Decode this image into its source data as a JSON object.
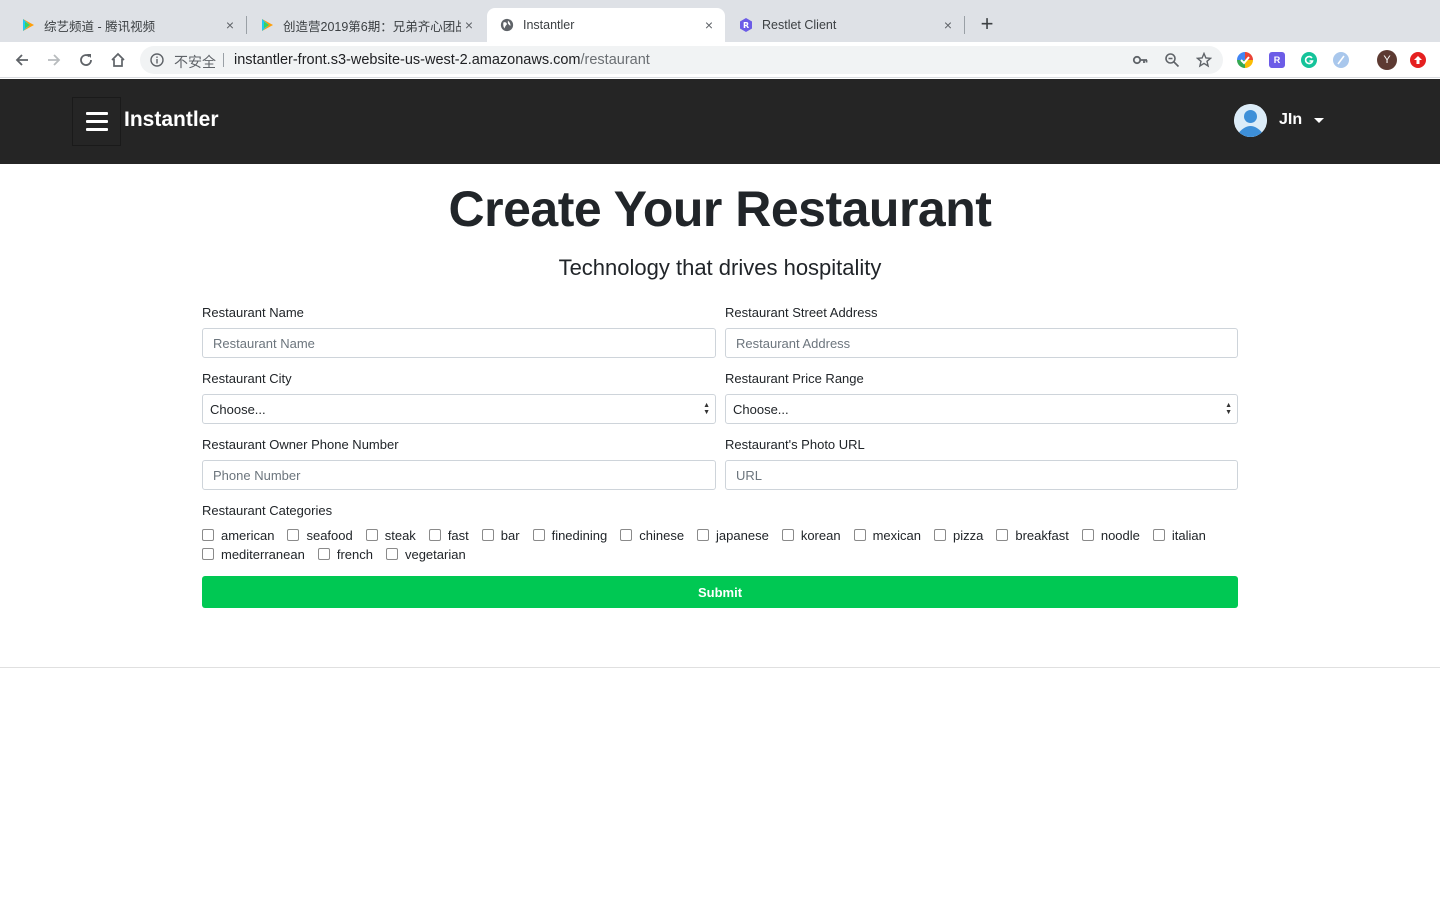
{
  "browser": {
    "tabs": [
      {
        "title": "综艺频道 - 腾讯视频",
        "favicon": "tencent-video-icon",
        "active": false
      },
      {
        "title": "创造营2019第6期：兄弟齐心团战",
        "favicon": "tencent-video-icon",
        "active": false
      },
      {
        "title": "Instantler",
        "favicon": "globe-icon",
        "active": true
      },
      {
        "title": "Restlet Client",
        "favicon": "restlet-icon",
        "active": false
      }
    ],
    "new_tab_symbol": "+",
    "close_symbol": "×",
    "security_label": "不安全",
    "url_host": "instantler-front.s3-website-us-west-2.amazonaws.com",
    "url_path": "/restaurant",
    "profile_initial": "Y",
    "extension_badge": "R"
  },
  "navbar": {
    "brand": "Instantler",
    "user_name": "JIn"
  },
  "page": {
    "title": "Create Your Restaurant",
    "subtitle": "Technology that drives hospitality"
  },
  "form": {
    "name": {
      "label": "Restaurant Name",
      "placeholder": "Restaurant Name"
    },
    "address": {
      "label": "Restaurant Street Address",
      "placeholder": "Restaurant Address"
    },
    "city": {
      "label": "Restaurant City",
      "selected": "Choose..."
    },
    "price": {
      "label": "Restaurant Price Range",
      "selected": "Choose..."
    },
    "phone": {
      "label": "Restaurant Owner Phone Number",
      "placeholder": "Phone Number"
    },
    "photo": {
      "label": "Restaurant's Photo URL",
      "placeholder": "URL"
    },
    "categories_label": "Restaurant Categories",
    "categories": [
      "american",
      "seafood",
      "steak",
      "fast",
      "bar",
      "finedining",
      "chinese",
      "japanese",
      "korean",
      "mexican",
      "pizza",
      "breakfast",
      "noodle",
      "italian",
      "mediterranean",
      "french",
      "vegetarian"
    ],
    "submit_label": "Submit"
  },
  "colors": {
    "navbar_bg": "#252525",
    "submit_bg": "#00c853"
  }
}
